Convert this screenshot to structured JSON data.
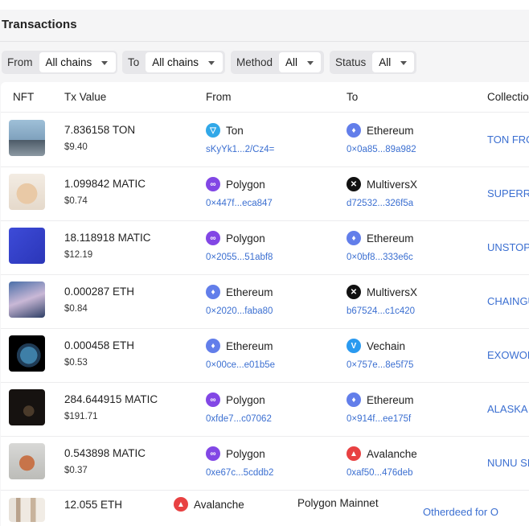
{
  "title": "Transactions",
  "filters": [
    {
      "label": "From",
      "value": "All chains"
    },
    {
      "label": "To",
      "value": "All chains"
    },
    {
      "label": "Method",
      "value": "All"
    },
    {
      "label": "Status",
      "value": "All"
    }
  ],
  "columns": [
    "NFT",
    "Tx Value",
    "From",
    "To",
    "Collection"
  ],
  "chain_colors": {
    "Ton": "#31a8e8",
    "Ethereum": "#627eea",
    "Polygon": "#8247e5",
    "MultiversX": "#111111",
    "Vechain": "#2a9af0",
    "Avalanche": "#e84142"
  },
  "rows": [
    {
      "value": "7.836158 TON",
      "usd": "$9.40",
      "from_chain": "Ton",
      "from_addr": "sKyYk1...2/Cz4=",
      "to_chain": "Ethereum",
      "to_addr": "0×0a85...89a982",
      "collection": "TON FROGS",
      "thumb": "skater"
    },
    {
      "value": "1.099842 MATIC",
      "usd": "$0.74",
      "from_chain": "Polygon",
      "from_addr": "0×447f...eca847",
      "to_chain": "MultiversX",
      "to_addr": "d72532...326f5a",
      "collection": "SUPERRARE BEARS",
      "thumb": "bear"
    },
    {
      "value": "18.118918 MATIC",
      "usd": "$12.19",
      "from_chain": "Polygon",
      "from_addr": "0×2055...51abf8",
      "to_chain": "Ethereum",
      "to_addr": "0×0bf8...333e6c",
      "collection": "UNSTOPPABLE",
      "thumb": "ud"
    },
    {
      "value": "0.000287 ETH",
      "usd": "$0.84",
      "from_chain": "Ethereum",
      "from_addr": "0×2020...faba80",
      "to_chain": "MultiversX",
      "to_addr": "b67524...c1c420",
      "collection": "CHAINGUARDIANS",
      "thumb": "anime"
    },
    {
      "value": "0.000458 ETH",
      "usd": "$0.53",
      "from_chain": "Ethereum",
      "from_addr": "0×00ce...e01b5e",
      "to_chain": "Vechain",
      "to_addr": "0×757e...8e5f75",
      "collection": "EXOWORLDS",
      "thumb": "planet"
    },
    {
      "value": "284.644915 MATIC",
      "usd": "$191.71",
      "from_chain": "Polygon",
      "from_addr": "0xfde7...c07062",
      "to_chain": "Ethereum",
      "to_addr": "0×914f...ee175f",
      "collection": "ALASKA GOLD",
      "thumb": "dark"
    },
    {
      "value": "0.543898 MATIC",
      "usd": "$0.37",
      "from_chain": "Polygon",
      "from_addr": "0xe67c...5cddb2",
      "to_chain": "Avalanche",
      "to_addr": "0xaf50...476deb",
      "collection": "NUNU SPIRITS",
      "thumb": "nunu"
    }
  ],
  "last_row": {
    "value": "12.055 ETH",
    "from_chain": "Avalanche",
    "to_chain": "Polygon Mainnet",
    "collection": "Otherdeed for O"
  }
}
